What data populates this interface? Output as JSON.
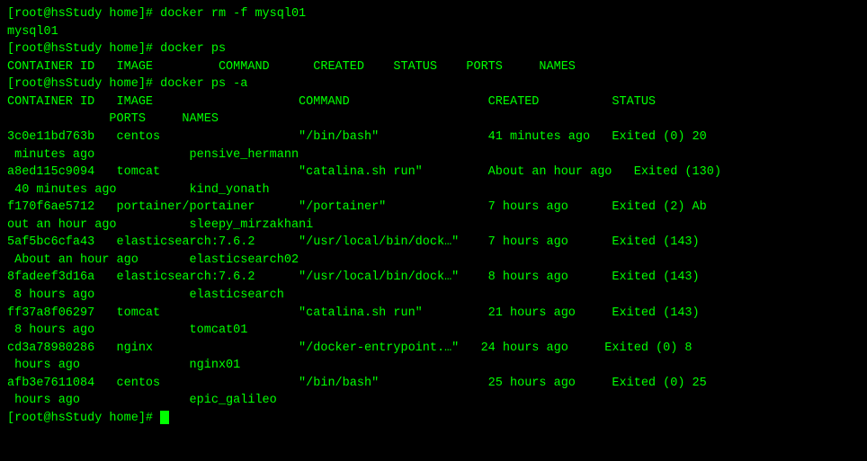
{
  "terminal": {
    "lines": [
      {
        "id": "line1",
        "text": "[root@hsStudy home]# docker rm -f mysql01"
      },
      {
        "id": "line2",
        "text": "mysql01"
      },
      {
        "id": "line3",
        "text": "[root@hsStudy home]# docker ps"
      },
      {
        "id": "line4",
        "text": "CONTAINER ID   IMAGE         COMMAND      CREATED    STATUS    PORTS     NAMES"
      },
      {
        "id": "line5",
        "text": "[root@hsStudy home]# docker ps -a"
      },
      {
        "id": "line6",
        "text": "CONTAINER ID   IMAGE                    COMMAND                   CREATED          STATUS"
      },
      {
        "id": "line7",
        "text": "              PORTS     NAMES"
      },
      {
        "id": "line8",
        "text": "3c0e11bd763b   centos                   \"/bin/bash\"               41 minutes ago   Exited (0) 20"
      },
      {
        "id": "line9",
        "text": " minutes ago             pensive_hermann"
      },
      {
        "id": "line10",
        "text": "a8ed115c9094   tomcat                   \"catalina.sh run\"         About an hour ago   Exited (130)"
      },
      {
        "id": "line11",
        "text": " 40 minutes ago          kind_yonath"
      },
      {
        "id": "line12",
        "text": "f170f6ae5712   portainer/portainer      \"/portainer\"              7 hours ago      Exited (2) Ab"
      },
      {
        "id": "line13",
        "text": "out an hour ago          sleepy_mirzakhani"
      },
      {
        "id": "line14",
        "text": "5af5bc6cfa43   elasticsearch:7.6.2      \"/usr/local/bin/dock…\"    7 hours ago      Exited (143)"
      },
      {
        "id": "line15",
        "text": " About an hour ago       elasticsearch02"
      },
      {
        "id": "line16",
        "text": "8fadeef3d16a   elasticsearch:7.6.2      \"/usr/local/bin/dock…\"    8 hours ago      Exited (143)"
      },
      {
        "id": "line17",
        "text": " 8 hours ago             elasticsearch"
      },
      {
        "id": "line18",
        "text": "ff37a8f06297   tomcat                   \"catalina.sh run\"         21 hours ago     Exited (143)"
      },
      {
        "id": "line19",
        "text": " 8 hours ago             tomcat01"
      },
      {
        "id": "line20",
        "text": "cd3a78980286   nginx                    \"/docker-entrypoint.…\"   24 hours ago     Exited (0) 8"
      },
      {
        "id": "line21",
        "text": " hours ago               nginx01"
      },
      {
        "id": "line22",
        "text": "afb3e7611084   centos                   \"/bin/bash\"               25 hours ago     Exited (0) 25"
      },
      {
        "id": "line23",
        "text": " hours ago               epic_galileo"
      },
      {
        "id": "line24",
        "text": "[root@hsStudy home]# "
      }
    ],
    "cursor_label": "cursor"
  }
}
